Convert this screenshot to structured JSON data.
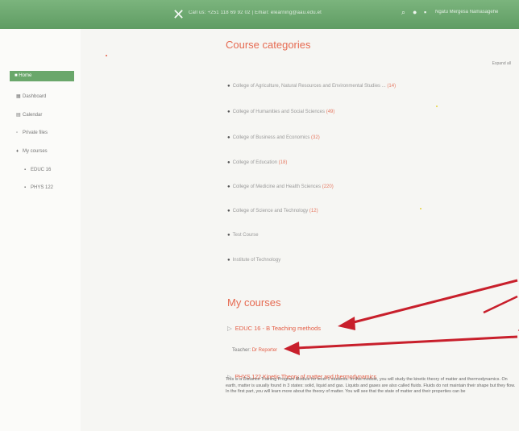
{
  "topbar": {
    "close_glyph": "✕",
    "contact": "Call us: +251 118 69 92 02 | Email: elearning@aau.edu.et",
    "search_glyph": "⌕",
    "user_glyph": "●",
    "chat_glyph": "▪",
    "username": "Ngatu Mergesa Namasagehe"
  },
  "sidebar": {
    "active": "Home",
    "items": [
      "Dashboard",
      "Calendar",
      "Private files",
      "My courses",
      "EDUC 16",
      "PHYS 122"
    ]
  },
  "course_categories": {
    "heading": "Course categories",
    "expand_label": "Expand all",
    "items": [
      {
        "label": "College of Agriculture, Natural Resources and Environmental Studies ...",
        "count": "(14)"
      },
      {
        "label": "College of Humanities and Social Sciences",
        "count": "(49)"
      },
      {
        "label": "College of Business and Economics",
        "count": "(32)"
      },
      {
        "label": "College of Education",
        "count": "(18)"
      },
      {
        "label": "College of Medicine and Health Sciences",
        "count": "(220)"
      },
      {
        "label": "College of Science and Technology",
        "count": "(12)"
      },
      {
        "label": "Test Course",
        "count": ""
      },
      {
        "label": "Institute of Technology",
        "count": ""
      }
    ]
  },
  "my_courses": {
    "heading": "My courses",
    "course1": "EDUC 16 - B Teaching methods",
    "teacher_label": "Teacher:",
    "teacher_name": "Dr Reporter",
    "course2": "PHYS 122 Kinetic Theory of matter and thermodynamics",
    "summary": "This is a Distance Training Program Module for level 1 students. In this module, you will study the kinetic theory of matter and thermodynamics. On earth, matter is usually found in 3 states: solid, liquid and gas. Liquids and gases are also called fluids. Fluids do not maintain their shape but they flow. In the first part, you will learn more about the theory of matter. You will see that the state of matter and their properties can be"
  },
  "colors": {
    "topbar": "#6aa76b",
    "accent": "#e45d45",
    "arrow": "#c81f2b"
  }
}
